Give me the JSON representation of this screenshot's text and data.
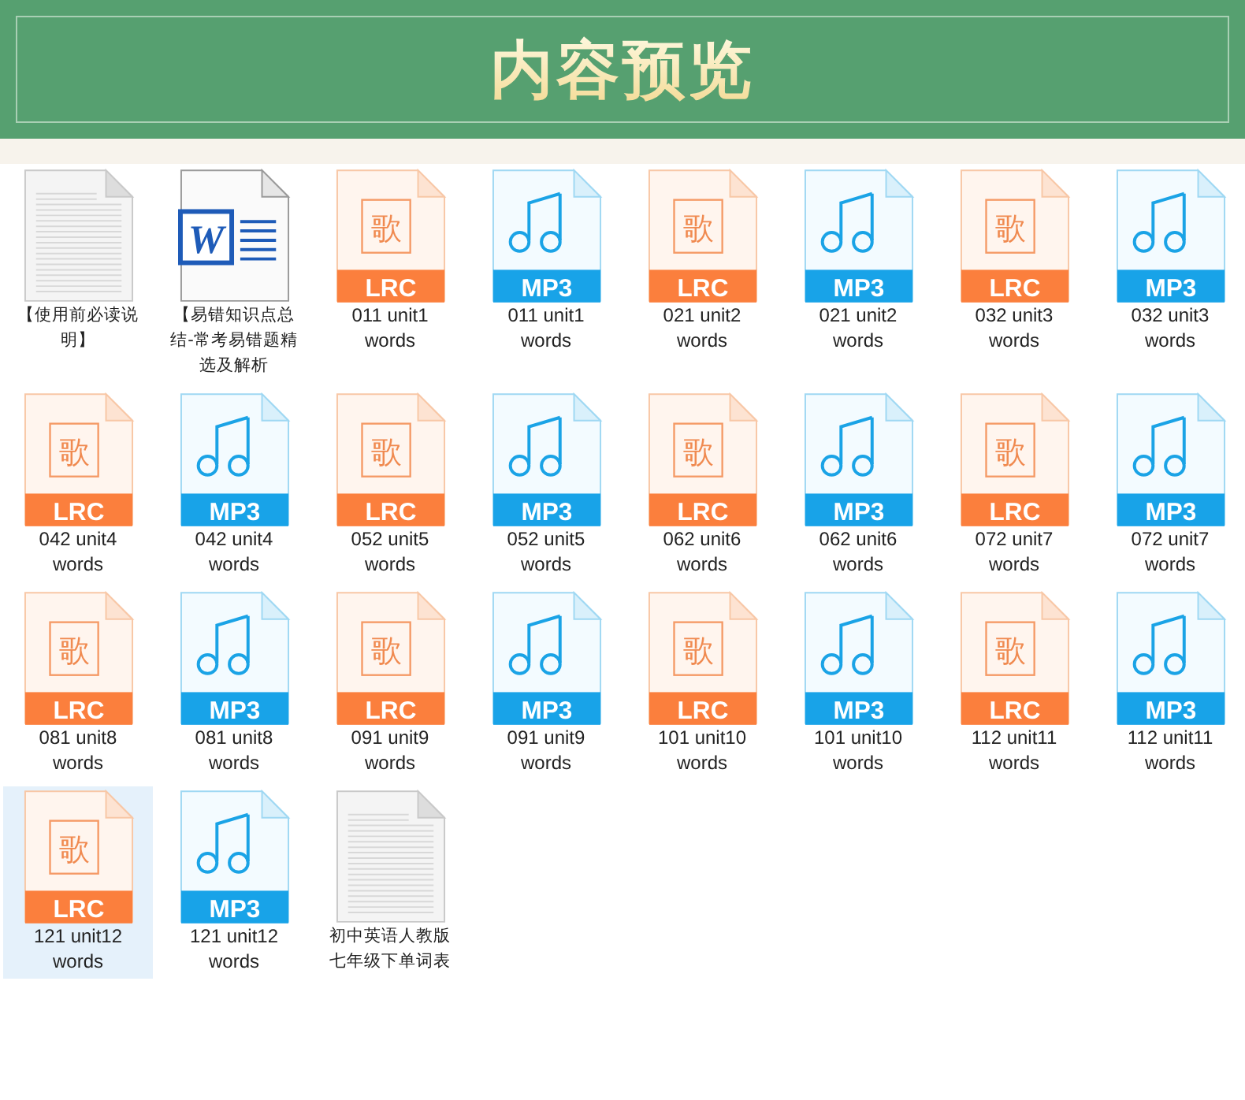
{
  "header": {
    "title": "内容预览"
  },
  "files": [
    {
      "kind": "txt",
      "label": "【使用前必读说明】",
      "selected": false
    },
    {
      "kind": "doc",
      "glyph": "W",
      "label": "【易错知识点总结-常考易错题精选及解析",
      "selected": false
    },
    {
      "kind": "lrc",
      "glyph": "歌",
      "badge": "LRC",
      "label": "011 unit1 words",
      "selected": false
    },
    {
      "kind": "mp3",
      "badge": "MP3",
      "label": "011 unit1 words",
      "selected": false
    },
    {
      "kind": "lrc",
      "glyph": "歌",
      "badge": "LRC",
      "label": "021 unit2 words",
      "selected": false
    },
    {
      "kind": "mp3",
      "badge": "MP3",
      "label": "021 unit2 words",
      "selected": false
    },
    {
      "kind": "lrc",
      "glyph": "歌",
      "badge": "LRC",
      "label": "032 unit3 words",
      "selected": false
    },
    {
      "kind": "mp3",
      "badge": "MP3",
      "label": "032 unit3 words",
      "selected": false
    },
    {
      "kind": "lrc",
      "glyph": "歌",
      "badge": "LRC",
      "label": "042 unit4 words",
      "selected": false
    },
    {
      "kind": "mp3",
      "badge": "MP3",
      "label": "042 unit4 words",
      "selected": false
    },
    {
      "kind": "lrc",
      "glyph": "歌",
      "badge": "LRC",
      "label": "052 unit5 words",
      "selected": false
    },
    {
      "kind": "mp3",
      "badge": "MP3",
      "label": "052 unit5 words",
      "selected": false
    },
    {
      "kind": "lrc",
      "glyph": "歌",
      "badge": "LRC",
      "label": "062 unit6 words",
      "selected": false
    },
    {
      "kind": "mp3",
      "badge": "MP3",
      "label": "062 unit6 words",
      "selected": false
    },
    {
      "kind": "lrc",
      "glyph": "歌",
      "badge": "LRC",
      "label": "072 unit7 words",
      "selected": false
    },
    {
      "kind": "mp3",
      "badge": "MP3",
      "label": "072 unit7 words",
      "selected": false
    },
    {
      "kind": "lrc",
      "glyph": "歌",
      "badge": "LRC",
      "label": "081 unit8 words",
      "selected": false
    },
    {
      "kind": "mp3",
      "badge": "MP3",
      "label": "081 unit8 words",
      "selected": false
    },
    {
      "kind": "lrc",
      "glyph": "歌",
      "badge": "LRC",
      "label": "091 unit9 words",
      "selected": false
    },
    {
      "kind": "mp3",
      "badge": "MP3",
      "label": "091 unit9 words",
      "selected": false
    },
    {
      "kind": "lrc",
      "glyph": "歌",
      "badge": "LRC",
      "label": "101 unit10 words",
      "selected": false
    },
    {
      "kind": "mp3",
      "badge": "MP3",
      "label": "101 unit10 words",
      "selected": false
    },
    {
      "kind": "lrc",
      "glyph": "歌",
      "badge": "LRC",
      "label": "112 unit11 words",
      "selected": false
    },
    {
      "kind": "mp3",
      "badge": "MP3",
      "label": "112 unit11 words",
      "selected": false
    },
    {
      "kind": "lrc",
      "glyph": "歌",
      "badge": "LRC",
      "label": "121 unit12 words",
      "selected": true
    },
    {
      "kind": "mp3",
      "badge": "MP3",
      "label": "121 unit12 words",
      "selected": false
    },
    {
      "kind": "txt",
      "label": "初中英语人教版七年级下单词表",
      "selected": false
    }
  ]
}
